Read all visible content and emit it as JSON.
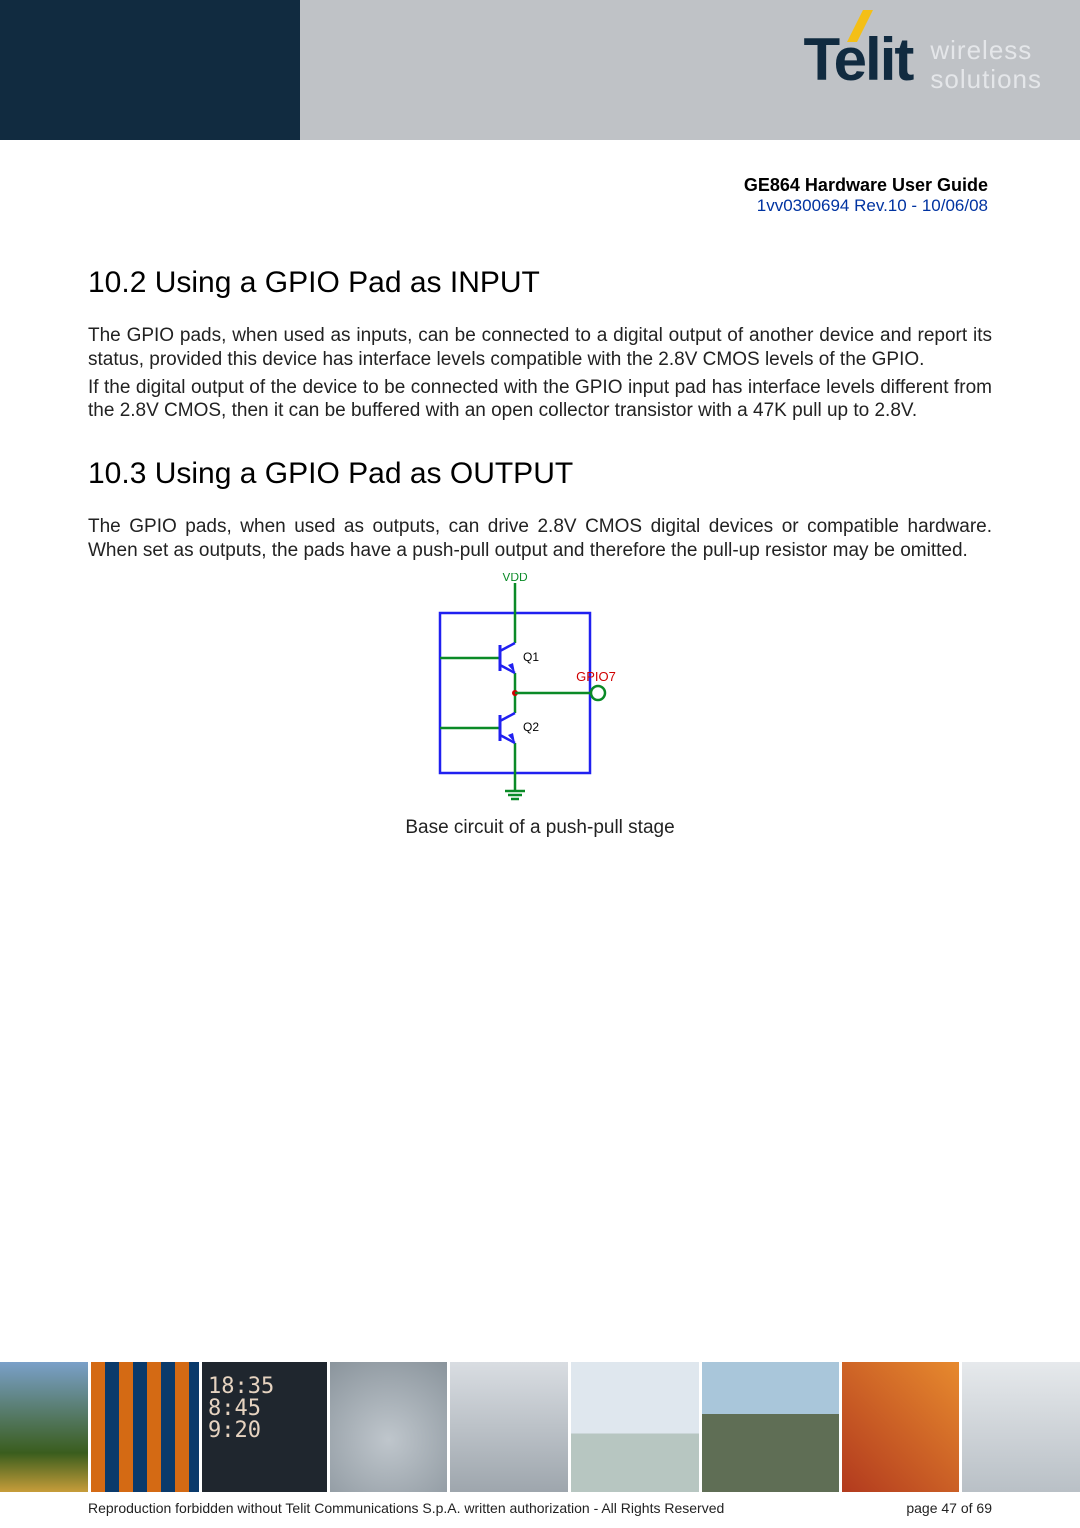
{
  "header": {
    "brand": "Telit",
    "tagline_line1": "wireless",
    "tagline_line2": "solutions"
  },
  "docmeta": {
    "title": "GE864 Hardware User Guide",
    "revision": "1vv0300694 Rev.10 - 10/06/08"
  },
  "sections": {
    "s102": {
      "heading": "10.2 Using a GPIO Pad as INPUT",
      "p1": "The GPIO pads, when used as inputs, can be connected to a digital output of another device and report its status, provided this device has interface levels compatible with the 2.8V CMOS levels of the GPIO.",
      "p2": "If the digital output of the device to be connected with the GPIO input pad has interface levels different from the 2.8V CMOS, then it can be buffered with an open collector transistor with a 47K pull up to 2.8V."
    },
    "s103": {
      "heading": "10.3 Using a GPIO Pad as OUTPUT",
      "p1": "The GPIO pads, when used as outputs, can drive 2.8V CMOS digital devices or compatible hardware. When set as outputs, the pads have a push-pull output and therefore the pull-up resistor may be omitted.",
      "caption": "Base circuit of a push-pull stage"
    }
  },
  "diagram": {
    "vdd": "VDD",
    "q1": "Q1",
    "q2": "Q2",
    "gpio": "GPIO7"
  },
  "legal": {
    "copyright": "Reproduction forbidden without Telit Communications S.p.A. written authorization - All Rights Reserved",
    "page": "page 47 of 69"
  }
}
